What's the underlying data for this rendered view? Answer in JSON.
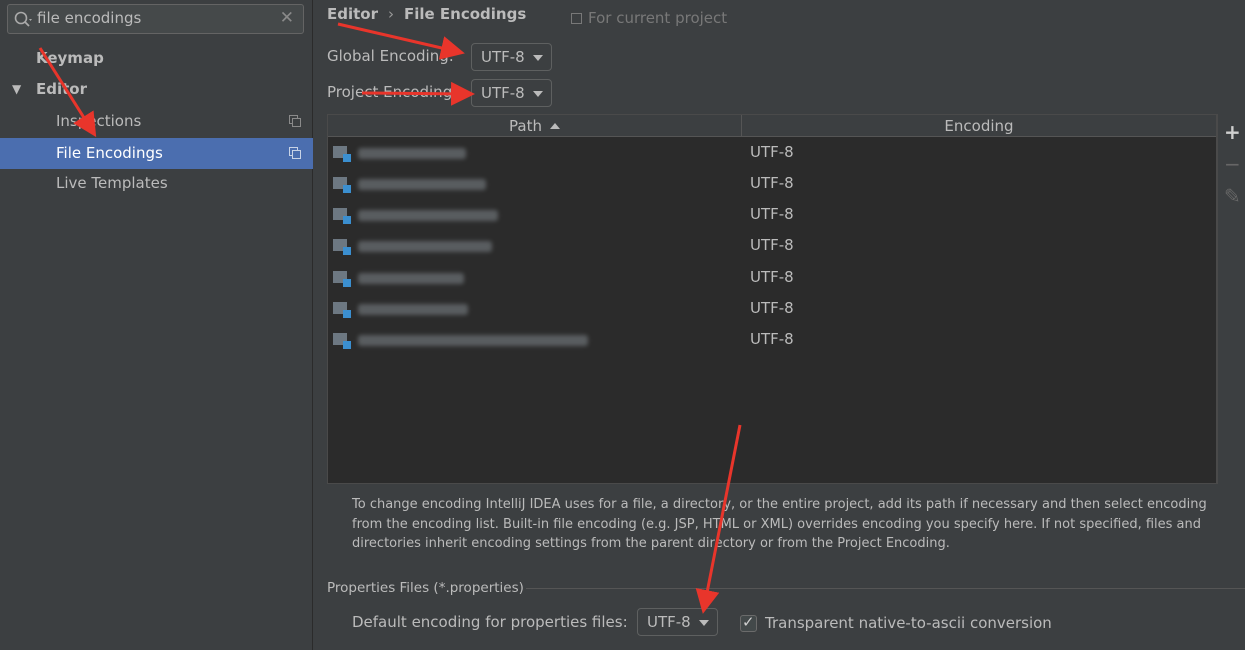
{
  "search": {
    "value": "file encodings",
    "icon": "search-icon",
    "clear_icon": "close-icon"
  },
  "sidebar": {
    "items": [
      {
        "label": "Keymap"
      },
      {
        "label": "Editor"
      },
      {
        "label": "Inspections"
      },
      {
        "label": "File Encodings"
      },
      {
        "label": "Live Templates"
      }
    ]
  },
  "breadcrumb": {
    "parent": "Editor",
    "sep": "›",
    "current": "File Encodings"
  },
  "scope_label": "For current project",
  "global_encoding": {
    "label": "Global Encoding:",
    "value": "UTF-8"
  },
  "project_encoding": {
    "label": "Project Encoding:",
    "value": "UTF-8"
  },
  "table": {
    "columns": [
      "Path",
      "Encoding"
    ],
    "rows": [
      {
        "encoding": "UTF-8"
      },
      {
        "encoding": "UTF-8"
      },
      {
        "encoding": "UTF-8"
      },
      {
        "encoding": "UTF-8"
      },
      {
        "encoding": "UTF-8"
      },
      {
        "encoding": "UTF-8"
      },
      {
        "encoding": "UTF-8"
      }
    ]
  },
  "tools": {
    "add": "+",
    "remove": "−",
    "edit": "✎"
  },
  "description": "To change encoding IntelliJ IDEA uses for a file, a directory, or the entire project, add its path if necessary and then select encoding from the encoding list. Built-in file encoding (e.g. JSP, HTML or XML) overrides encoding you specify here. If not specified, files and directories inherit encoding settings from the parent directory or from the Project Encoding.",
  "properties": {
    "group_title": "Properties Files (*.properties)",
    "default_label": "Default encoding for properties files:",
    "default_value": "UTF-8",
    "transparent_label": "Transparent native-to-ascii conversion",
    "transparent_checked": true
  },
  "colors": {
    "selection": "#4b6eaf",
    "annotation_arrow": "#e8352b"
  }
}
